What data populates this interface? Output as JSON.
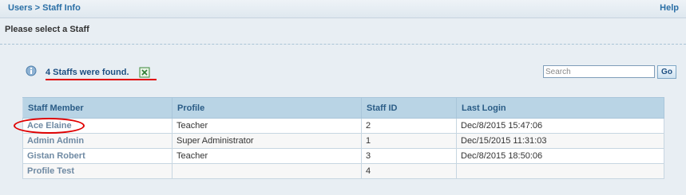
{
  "header": {
    "breadcrumb_users": "Users",
    "breadcrumb_sep": ">",
    "breadcrumb_current": "Staff Info",
    "help": "Help"
  },
  "subheader": {
    "prompt": "Please select a Staff"
  },
  "results": {
    "found_text": "4 Staffs were found."
  },
  "search": {
    "placeholder": "Search",
    "value": "",
    "go_label": "Go"
  },
  "table": {
    "columns": [
      "Staff Member",
      "Profile",
      "Staff ID",
      "Last Login"
    ],
    "rows": [
      {
        "name": "Ace Elaine",
        "profile": "Teacher",
        "staff_id": "2",
        "last_login": "Dec/8/2015 15:47:06"
      },
      {
        "name": "Admin Admin",
        "profile": "Super Administrator",
        "staff_id": "1",
        "last_login": "Dec/15/2015 11:31:03"
      },
      {
        "name": "Gistan Robert",
        "profile": "Teacher",
        "staff_id": "3",
        "last_login": "Dec/8/2015 18:50:06"
      },
      {
        "name": "Profile Test",
        "profile": "",
        "staff_id": "4",
        "last_login": ""
      }
    ]
  },
  "icons": {
    "info": "info-icon",
    "export": "excel-export-icon"
  },
  "colors": {
    "accent": "#2a6fa6",
    "highlight": "#e00000",
    "header_bg": "#b9d4e5"
  }
}
